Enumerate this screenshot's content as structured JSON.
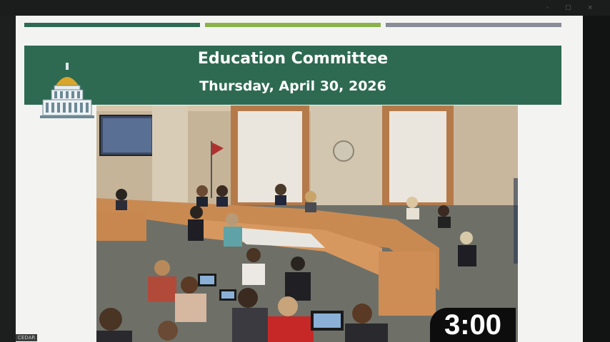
{
  "window": {
    "controls_label": "- □ ×"
  },
  "slide": {
    "title": "Education Committee",
    "date": "Thursday, April 30, 2026",
    "stripe_colors": [
      "#2e6a54",
      "#8bb24a",
      "#8a8d98"
    ],
    "banner_color": "#2e6a52"
  },
  "video": {
    "timer": "3:00"
  },
  "stream_label": "CEDAR"
}
